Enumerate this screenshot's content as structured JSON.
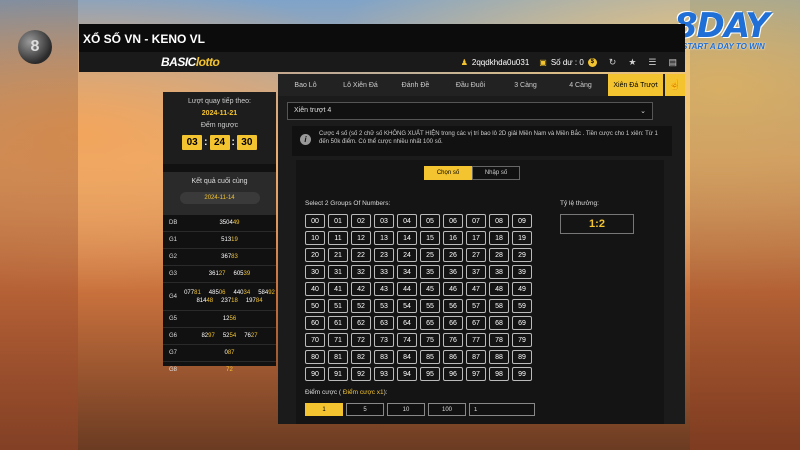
{
  "page": {
    "title": "XỔ SỐ VN - KENO VL"
  },
  "decor": {
    "ball_number": "8"
  },
  "brand": {
    "word": "8DAY",
    "tagline": "START A DAY TO WIN"
  },
  "topbar": {
    "logo_main": "BASIC",
    "logo_accent": "lotto",
    "username": "2qqdkhda0u031",
    "balance_label": "Số dư : 0"
  },
  "sidebar": {
    "next_draw_label": "Lượt quay tiếp theo:",
    "next_draw_date": "2024-11-21",
    "countdown_label": "Đếm ngược",
    "countdown": {
      "h": "03",
      "m": "24",
      "s": "30"
    },
    "last_result_label": "Kết quả cuối cùng",
    "last_result_date": "2024-11-14",
    "results": [
      {
        "label": "DB",
        "values": [
          {
            "a": "3504",
            "b": "49"
          }
        ]
      },
      {
        "label": "G1",
        "values": [
          {
            "a": "513",
            "b": "19"
          }
        ]
      },
      {
        "label": "G2",
        "values": [
          {
            "a": "367",
            "b": "83"
          }
        ]
      },
      {
        "label": "G3",
        "values": [
          {
            "a": "361",
            "b": "27"
          },
          {
            "a": "605",
            "b": "39"
          }
        ]
      },
      {
        "label": "G4",
        "values": [
          {
            "a": "077",
            "b": "81"
          },
          {
            "a": "485",
            "b": "06"
          },
          {
            "a": "440",
            "b": "34"
          },
          {
            "a": "584",
            "b": "92"
          },
          {
            "a": "814",
            "b": "48"
          },
          {
            "a": "237",
            "b": "18"
          },
          {
            "a": "197",
            "b": "84"
          }
        ]
      },
      {
        "label": "G5",
        "values": [
          {
            "a": "12",
            "b": "56"
          }
        ]
      },
      {
        "label": "G6",
        "values": [
          {
            "a": "82",
            "b": "97"
          },
          {
            "a": "52",
            "b": "54"
          },
          {
            "a": "76",
            "b": "27"
          }
        ]
      },
      {
        "label": "G7",
        "values": [
          {
            "a": "0",
            "b": "87"
          }
        ]
      },
      {
        "label": "G8",
        "values": [
          {
            "a": "",
            "b": "72"
          }
        ]
      }
    ]
  },
  "tabs": [
    {
      "label": "Bao Lô"
    },
    {
      "label": "Lô Xiên Đá"
    },
    {
      "label": "Đánh Đề"
    },
    {
      "label": "Đầu Đuôi"
    },
    {
      "label": "3 Càng"
    },
    {
      "label": "4 Càng"
    },
    {
      "label": "Xiên Đá Trượt"
    }
  ],
  "active_tab": "Xiên Đá Trượt",
  "main": {
    "select_value": "Xiên trượt 4",
    "info_text": "Cược 4 số (số 2 chữ số KHÔNG XUẤT HIỆN trong các vị trí bao lô 2D giải Miền Nam và Miền Bắc . Tiền cược cho 1 xiên: Từ 1 đến 50k điểm. Có thể cược nhiều nhất 100 số.",
    "mode_choose": "Chọn số",
    "mode_input": "Nhập số",
    "groups_label": "Select 2 Groups Of Numbers:",
    "ratio_label": "Tỷ lệ thưởng:",
    "ratio_value": "1:2",
    "bet_label": "Điểm cược ( ",
    "bet_label_accent": "Điểm cược x1",
    "bet_label_end": "):",
    "bet_options": [
      "1",
      "5",
      "10",
      "100"
    ],
    "bet_input_value": "1"
  },
  "colors": {
    "accent": "#f4c430",
    "panel": "#1b1b1b",
    "brand_blue": "#1f6fd6"
  }
}
